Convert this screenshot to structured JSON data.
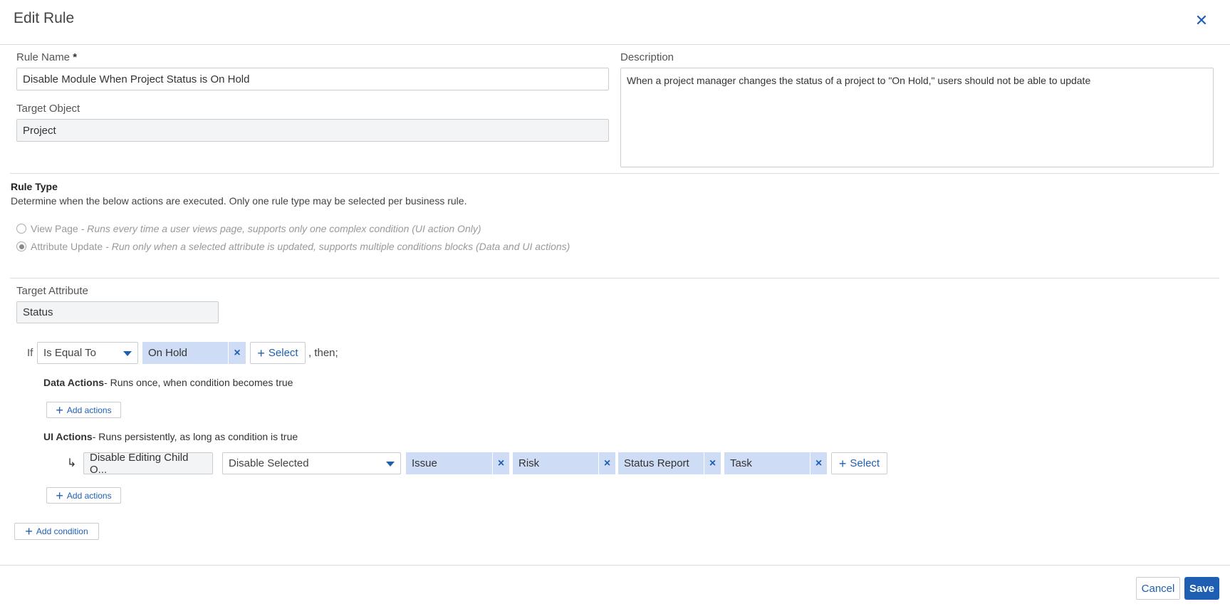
{
  "dialog": {
    "title": "Edit Rule"
  },
  "rule_name": {
    "label": "Rule Name",
    "required_mark": "*",
    "value": "Disable Module When Project Status is On Hold"
  },
  "target_object": {
    "label": "Target Object",
    "value": "Project"
  },
  "description": {
    "label": "Description",
    "value": "When a project manager changes the status of a project to \"On Hold,\" users should not be able to update"
  },
  "rule_type": {
    "title": "Rule Type",
    "description": "Determine when the below actions are executed. Only one rule type may be selected per business rule.",
    "options": [
      {
        "label": "View Page",
        "detail": "- Runs every time a user views page, supports only one complex condition (UI action Only)",
        "selected": false
      },
      {
        "label": "Attribute Update",
        "detail": "- Run only when a selected attribute is updated, supports multiple conditions blocks (Data and UI actions)",
        "selected": true
      }
    ]
  },
  "target_attribute": {
    "label": "Target Attribute",
    "value": "Status"
  },
  "condition": {
    "if_label": "If",
    "operator": "Is Equal To",
    "value_chip": "On Hold",
    "select_label": "Select",
    "then_label": ", then;"
  },
  "data_actions": {
    "title": "Data Actions",
    "desc": "- Runs once, when condition becomes true",
    "add_label": "Add actions"
  },
  "ui_actions": {
    "title": "UI Actions",
    "desc": "- Runs persistently, as long as condition is true",
    "action_name": "Disable Editing Child O...",
    "mode": "Disable Selected",
    "chips": [
      "Issue",
      "Risk",
      "Status Report",
      "Task"
    ],
    "select_label": "Select",
    "add_label": "Add actions"
  },
  "add_condition_label": "Add condition",
  "footer": {
    "cancel_label": "Cancel",
    "save_label": "Save"
  }
}
